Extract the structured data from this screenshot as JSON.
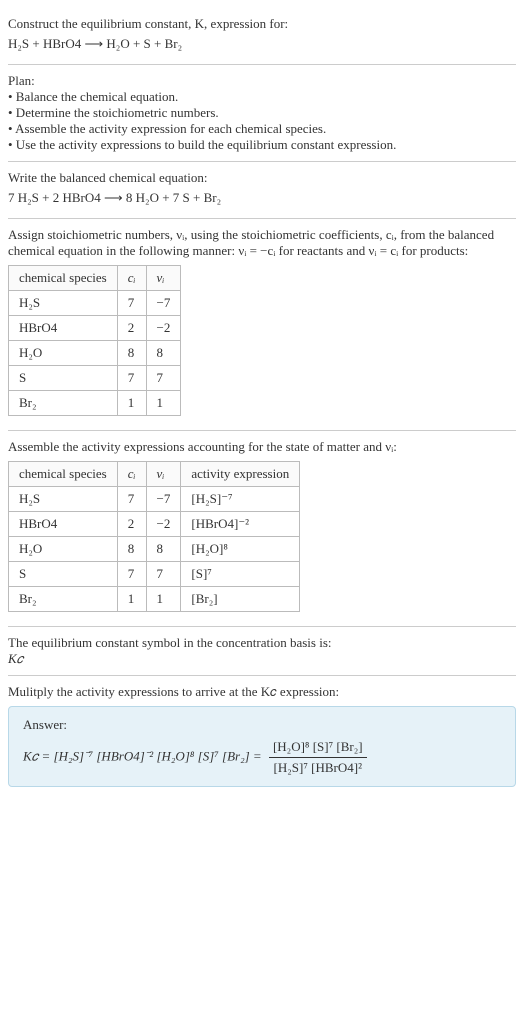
{
  "header": {
    "line1": "Construct the equilibrium constant, K, expression for:",
    "eq": "H₂S + HBrO4  ⟶  H₂O + S + Br₂"
  },
  "plan": {
    "title": "Plan:",
    "items": [
      "• Balance the chemical equation.",
      "• Determine the stoichiometric numbers.",
      "• Assemble the activity expression for each chemical species.",
      "• Use the activity expressions to build the equilibrium constant expression."
    ]
  },
  "balanced": {
    "title": "Write the balanced chemical equation:",
    "eq": "7 H₂S + 2 HBrO4  ⟶  8 H₂O + 7 S + Br₂"
  },
  "stoich": {
    "intro": "Assign stoichiometric numbers, νᵢ, using the stoichiometric coefficients, cᵢ, from the balanced chemical equation in the following manner: νᵢ = −cᵢ for reactants and νᵢ = cᵢ for products:",
    "headers": {
      "a": "chemical species",
      "b": "cᵢ",
      "c": "νᵢ"
    },
    "rows": [
      {
        "a": "H₂S",
        "b": "7",
        "c": "−7"
      },
      {
        "a": "HBrO4",
        "b": "2",
        "c": "−2"
      },
      {
        "a": "H₂O",
        "b": "8",
        "c": "8"
      },
      {
        "a": "S",
        "b": "7",
        "c": "7"
      },
      {
        "a": "Br₂",
        "b": "1",
        "c": "1"
      }
    ]
  },
  "activity": {
    "intro": "Assemble the activity expressions accounting for the state of matter and νᵢ:",
    "headers": {
      "a": "chemical species",
      "b": "cᵢ",
      "c": "νᵢ",
      "d": "activity expression"
    },
    "rows": [
      {
        "a": "H₂S",
        "b": "7",
        "c": "−7",
        "d": "[H₂S]⁻⁷"
      },
      {
        "a": "HBrO4",
        "b": "2",
        "c": "−2",
        "d": "[HBrO4]⁻²"
      },
      {
        "a": "H₂O",
        "b": "8",
        "c": "8",
        "d": "[H₂O]⁸"
      },
      {
        "a": "S",
        "b": "7",
        "c": "7",
        "d": "[S]⁷"
      },
      {
        "a": "Br₂",
        "b": "1",
        "c": "1",
        "d": "[Br₂]"
      }
    ]
  },
  "kc_def": {
    "line": "The equilibrium constant symbol in the concentration basis is:",
    "sym": "K𝑐"
  },
  "multiply": {
    "line": "Mulitply the activity expressions to arrive at the K𝑐 expression:"
  },
  "answer": {
    "label": "Answer:",
    "lhs": "K𝑐 = [H₂S]⁻⁷ [HBrO4]⁻² [H₂O]⁸ [S]⁷ [Br₂] = ",
    "num": "[H₂O]⁸ [S]⁷ [Br₂]",
    "den": "[H₂S]⁷ [HBrO4]²"
  }
}
